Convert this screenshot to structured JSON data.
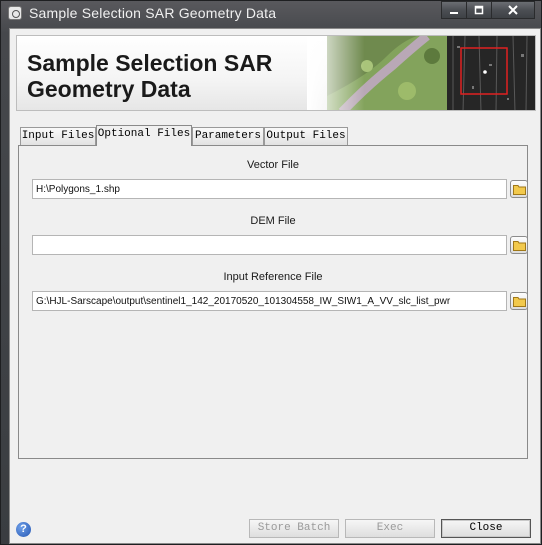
{
  "window": {
    "title": "Sample Selection SAR Geometry Data",
    "controls": {
      "minimize": "minimize-icon",
      "maximize": "maximize-icon",
      "close": "close-icon"
    }
  },
  "banner": {
    "title_line1": "Sample Selection SAR",
    "title_line2": "Geometry Data"
  },
  "tabs": [
    {
      "label": "Input Files",
      "active": false
    },
    {
      "label": "Optional Files",
      "active": true
    },
    {
      "label": "Parameters",
      "active": false
    },
    {
      "label": "Output Files",
      "active": false
    }
  ],
  "fields": {
    "vector": {
      "label": "Vector File",
      "value": "H:\\Polygons_1.shp"
    },
    "dem": {
      "label": "DEM File",
      "value": ""
    },
    "reference": {
      "label": "Input Reference File",
      "value": "G:\\HJL-Sarscape\\output\\sentinel1_142_20170520_101304558_IW_SIW1_A_VV_slc_list_pwr"
    }
  },
  "buttons": {
    "store_batch": {
      "label": "Store Batch",
      "enabled": false
    },
    "exec": {
      "label": "Exec",
      "enabled": false
    },
    "close": {
      "label": "Close",
      "enabled": true
    }
  },
  "help": {
    "glyph": "?"
  },
  "colors": {
    "frame": "#3b3f44",
    "client": "#f0f0f0",
    "help_blue": "#2556b3",
    "banner_marker": "#e02020"
  }
}
